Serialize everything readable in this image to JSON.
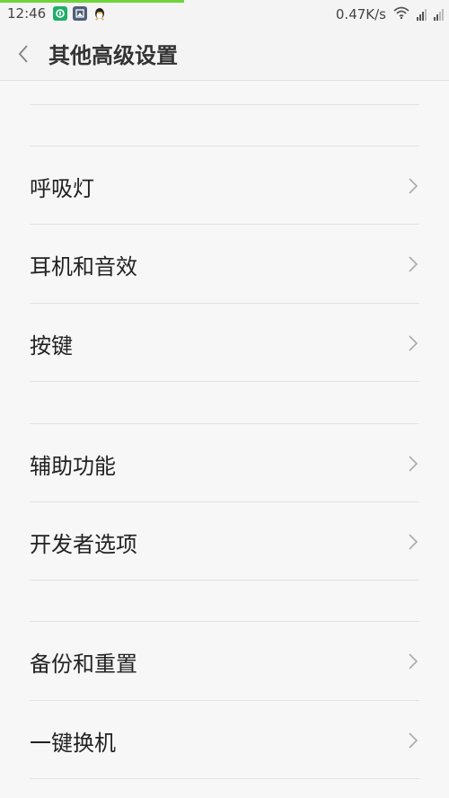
{
  "status_bar": {
    "time": "12:46",
    "speed": "0.47K/s",
    "notification_icons": [
      "green-app-icon",
      "album-app-icon",
      "qq-penguin-icon"
    ],
    "system_icons": [
      "wifi-icon",
      "signal-icon",
      "signal-icon"
    ]
  },
  "header": {
    "title": "其他高级设置",
    "back_icon": "chevron-left-icon"
  },
  "menu": {
    "items": [
      {
        "label": "呼吸灯"
      },
      {
        "label": "耳机和音效"
      },
      {
        "label": "按键"
      },
      {
        "label": "辅助功能"
      },
      {
        "label": "开发者选项"
      },
      {
        "label": "备份和重置"
      },
      {
        "label": "一键换机"
      }
    ]
  },
  "colors": {
    "background": "#f7f7f7",
    "divider": "#e2e2e2",
    "progress": "#6fd43c"
  }
}
